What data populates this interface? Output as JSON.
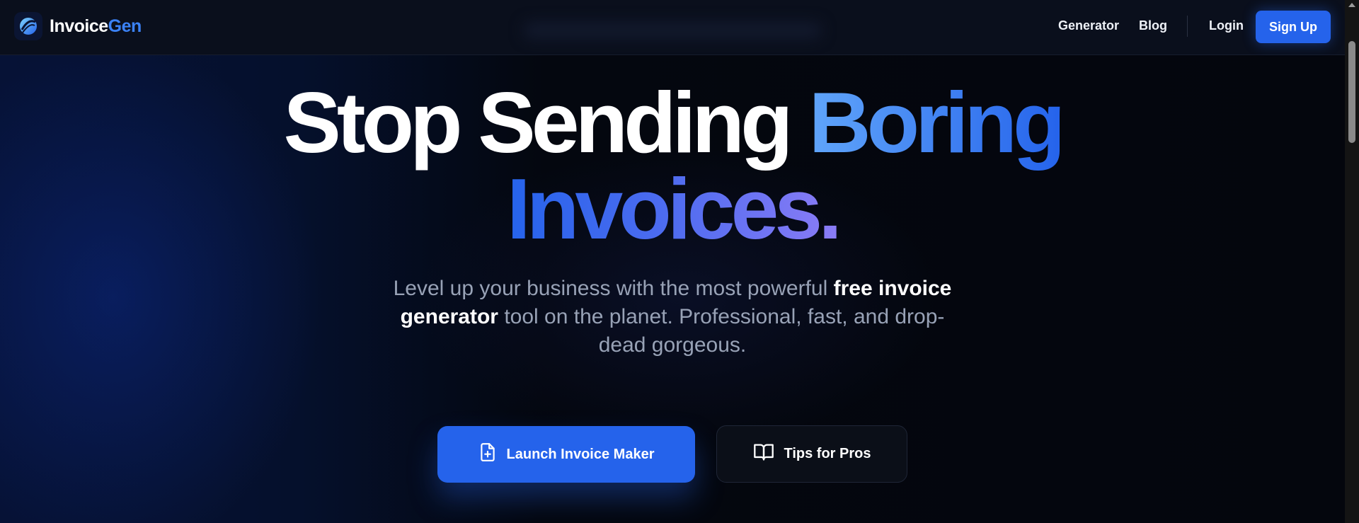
{
  "header": {
    "logo_text_part1": "Invoice",
    "logo_text_part2": "Gen",
    "nav": [
      "Generator",
      "Blog"
    ],
    "login_label": "Login",
    "signup_label": "Sign Up"
  },
  "hero": {
    "title_white": "Stop Sending ",
    "title_accent": "Boring",
    "title_line2": "Invoices.",
    "subtitle_part1": "Level up your business with the most powerful ",
    "subtitle_bold": "free invoice generator",
    "subtitle_part2": " tool on the planet. Professional, fast, and drop-dead gorgeous.",
    "primary_cta": "Launch Invoice Maker",
    "primary_icon": "file-plus-icon",
    "secondary_cta": "Tips for Pros",
    "secondary_icon": "book-open-icon"
  },
  "colors": {
    "accent": "#2563eb",
    "accent_light": "#60a5fa",
    "background": "#04060f"
  }
}
